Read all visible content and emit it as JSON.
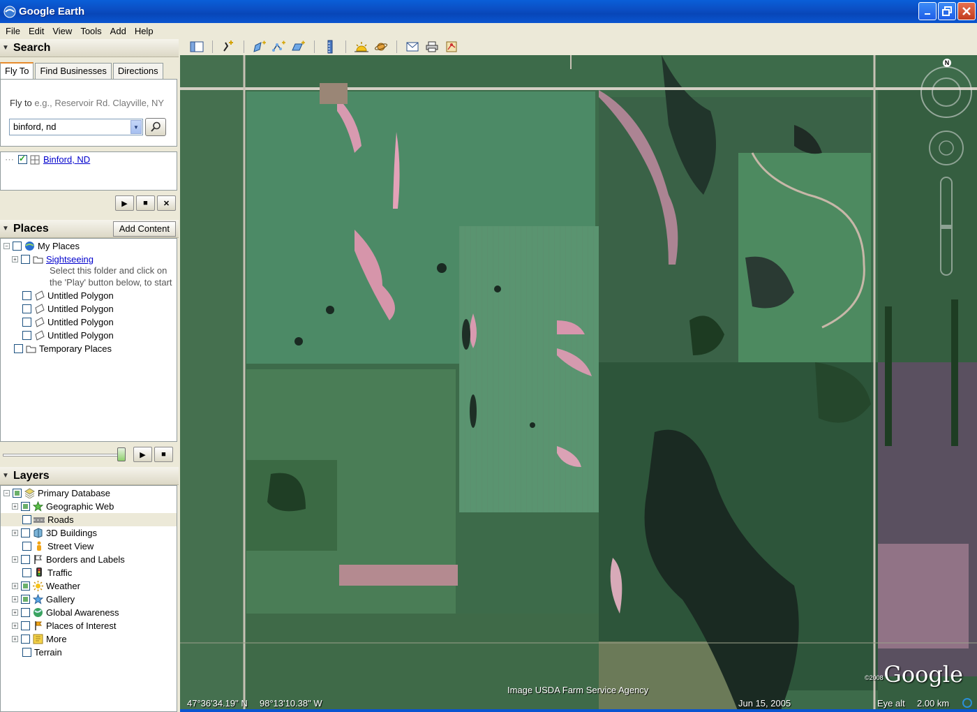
{
  "window": {
    "title": "Google Earth"
  },
  "menu": [
    "File",
    "Edit",
    "View",
    "Tools",
    "Add",
    "Help"
  ],
  "search": {
    "header": "Search",
    "tabs": [
      "Fly To",
      "Find Businesses",
      "Directions"
    ],
    "fly_label": "Fly to",
    "fly_hint": "e.g., Reservoir Rd. Clayville, NY",
    "query": "binford, nd",
    "result": "Binford, ND"
  },
  "places": {
    "header": "Places",
    "add_content": "Add Content",
    "items": [
      {
        "label": "My Places"
      },
      {
        "label": "Sightseeing"
      },
      {
        "label": "Untitled Polygon"
      },
      {
        "label": "Untitled Polygon"
      },
      {
        "label": "Untitled Polygon"
      },
      {
        "label": "Untitled Polygon"
      },
      {
        "label": "Temporary Places"
      }
    ],
    "sightseeing_note_1": "Select this folder and click on",
    "sightseeing_note_2": "the 'Play' button below, to start"
  },
  "layers": {
    "header": "Layers",
    "items": [
      {
        "label": "Primary Database"
      },
      {
        "label": "Geographic Web"
      },
      {
        "label": "Roads"
      },
      {
        "label": "3D Buildings"
      },
      {
        "label": "Street View"
      },
      {
        "label": "Borders and Labels"
      },
      {
        "label": "Traffic"
      },
      {
        "label": "Weather"
      },
      {
        "label": "Gallery"
      },
      {
        "label": "Global Awareness"
      },
      {
        "label": "Places of Interest"
      },
      {
        "label": "More"
      },
      {
        "label": "Terrain"
      }
    ]
  },
  "map": {
    "lat": "47°36'34.19\" N",
    "lon": "98°13'10.38\" W",
    "imagery_credit": "Image USDA Farm Service Agency",
    "date": "Jun 15, 2005",
    "eye_alt_label": "Eye alt",
    "eye_alt_value": "2.00 km",
    "copyright": "©2008",
    "logo": "Google",
    "compass_n": "N"
  },
  "colors": {
    "accent": "#0a55d0",
    "link": "#0000cc"
  }
}
